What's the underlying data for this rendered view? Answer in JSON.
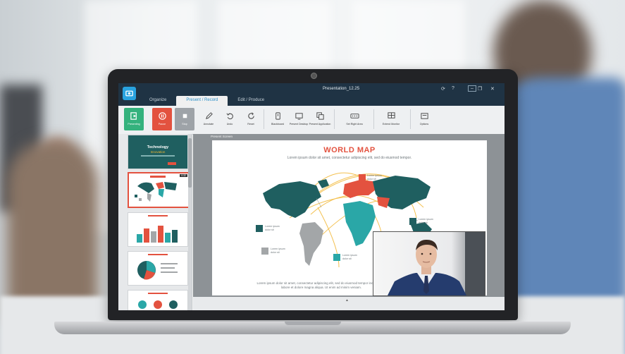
{
  "app": {
    "window_title": "Presentation_12.25",
    "tabs": [
      {
        "label": "Organize"
      },
      {
        "label": "Present / Record"
      },
      {
        "label": "Edit / Produce"
      }
    ],
    "window_controls": [
      "⟳",
      "?",
      "–",
      "❐",
      "✕"
    ]
  },
  "ribbon": {
    "buttons": [
      {
        "label": "Presenting"
      },
      {
        "label": "Pause"
      },
      {
        "label": "Stop"
      },
      {
        "label": "Annotate"
      },
      {
        "label": "Undo"
      },
      {
        "label": "Reset"
      },
      {
        "label": "Blackboard"
      },
      {
        "label": "Present Desktop"
      },
      {
        "label": "Present Application"
      },
      {
        "label": "Set Right Area"
      },
      {
        "label": "Extend Monitor"
      },
      {
        "label": "Options"
      }
    ]
  },
  "thumbnails": {
    "first_title": "Technology",
    "first_subtitle": "Innovation",
    "selected_badge": "0:32"
  },
  "present": {
    "header": "Present Screen"
  },
  "slide": {
    "title": "WORLD MAP",
    "subtitle": "Lorem ipsum dolor sit amet, consectetur adipiscing elit, sed do eiusmod tempor.",
    "footer": "Lorem ipsum dolor sit amet, consectetur adipiscing elit, sed do eiusmod tempor incididunt ut labore et dolore magna aliqua. Ut enim ad minim veniam.",
    "legend_text": "Lorem ipsum dolor sit",
    "colors": {
      "title": "#e3523f",
      "teal_dark": "#1f5f60",
      "teal_light": "#2aa7a7",
      "gray": "#a3a6a8",
      "orange": "#e3523f",
      "arcs": "#f2b632"
    }
  }
}
